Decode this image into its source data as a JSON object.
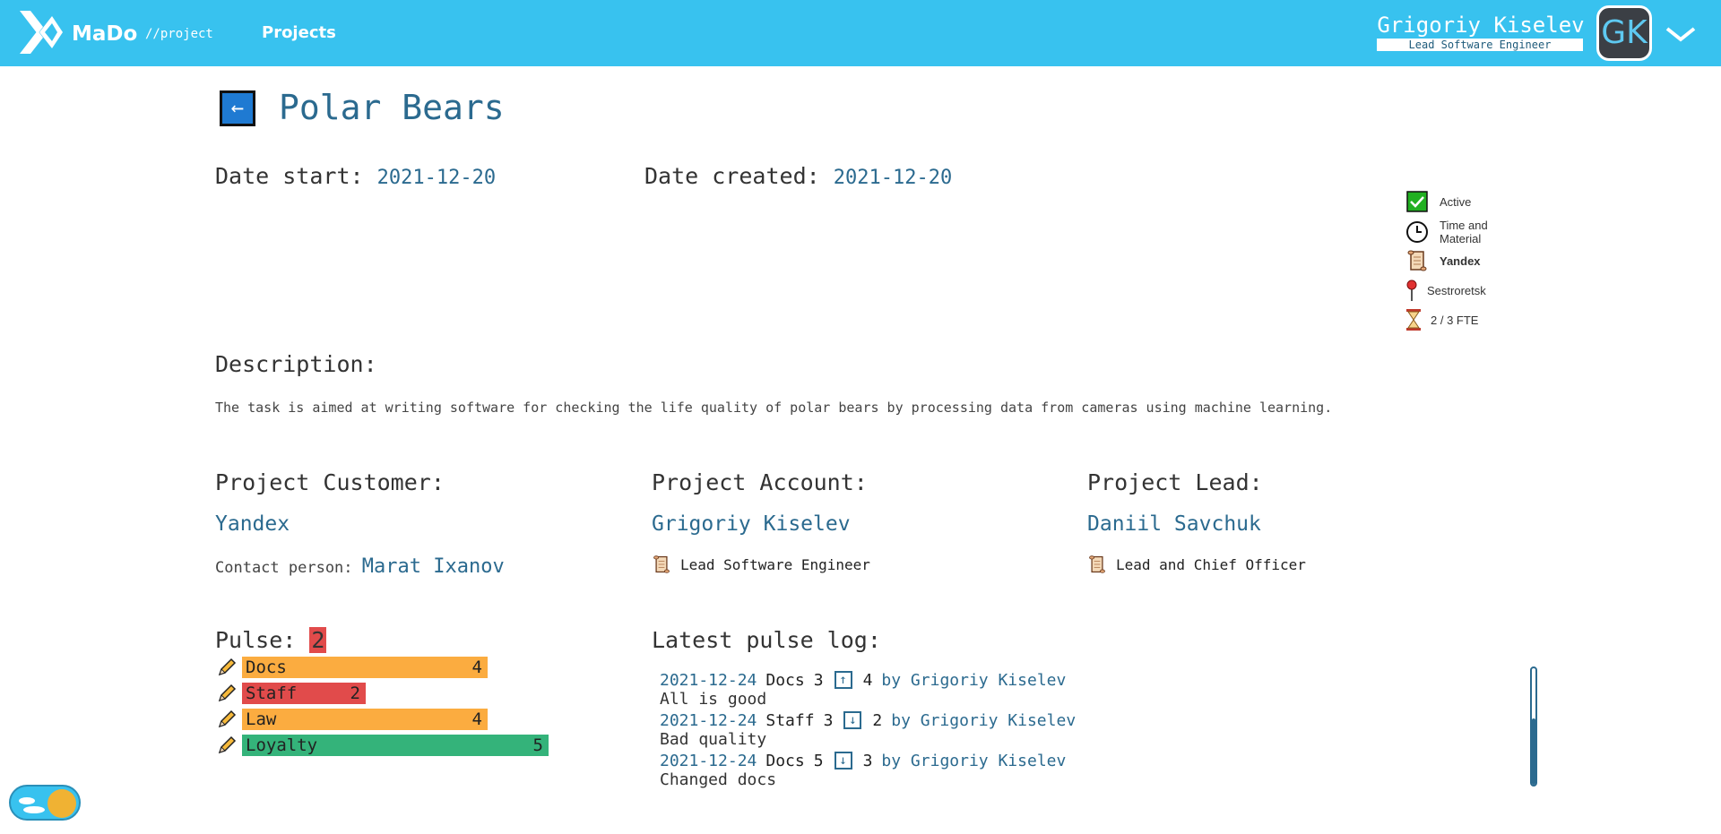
{
  "header": {
    "brand": "MaDo",
    "brand_sub": "//project",
    "nav_projects": "Projects",
    "user_name": "Grigoriy Kiselev",
    "user_role": "Lead Software Engineer",
    "avatar_initials": "GK",
    "accent_color": "#38c2ef"
  },
  "project": {
    "back_label": "←",
    "title": "Polar Bears",
    "date_start_label": "Date start:",
    "date_start": "2021-12-20",
    "date_created_label": "Date created:",
    "date_created": "2021-12-20",
    "description_label": "Description:",
    "description": "The task is aimed at writing software for checking the life quality of polar bears by processing data from cameras using machine learning."
  },
  "status": {
    "active": "Active",
    "contract_type_line1": "Time and",
    "contract_type_line2": "Material",
    "customer": "Yandex",
    "location": "Sestroretsk",
    "fte": "2 / 3 FTE"
  },
  "customer": {
    "label": "Project Customer:",
    "name": "Yandex",
    "contact_label": "Contact person:",
    "contact_name": "Marat Ixanov"
  },
  "account": {
    "label": "Project Account:",
    "name": "Grigoriy Kiselev",
    "role": "Lead Software Engineer"
  },
  "lead": {
    "label": "Project Lead:",
    "name": "Daniil Savchuk",
    "role": "Lead and Chief Officer"
  },
  "pulse": {
    "label": "Pulse:",
    "value": "2",
    "max": 5,
    "items": [
      {
        "name": "Docs",
        "value": "4",
        "score": 4,
        "color": "#fbac40"
      },
      {
        "name": "Staff",
        "value": "2",
        "score": 2,
        "color": "#e14b4b"
      },
      {
        "name": "Law",
        "value": "4",
        "score": 4,
        "color": "#fbac40"
      },
      {
        "name": "Loyalty",
        "value": "5",
        "score": 5,
        "color": "#34b37a"
      }
    ]
  },
  "pulse_log": {
    "label": "Latest pulse log:",
    "entries": [
      {
        "date": "2021-12-24",
        "key": "Docs",
        "old": "3",
        "direction": "up",
        "arrow": "↑",
        "new": "4",
        "by": "by Grigoriy Kiselev",
        "comment": "All is good"
      },
      {
        "date": "2021-12-24",
        "key": "Staff",
        "old": "3",
        "direction": "down",
        "arrow": "↓",
        "new": "2",
        "by": "by Grigoriy Kiselev",
        "comment": "Bad quality"
      },
      {
        "date": "2021-12-24",
        "key": "Docs",
        "old": "5",
        "direction": "down",
        "arrow": "↓",
        "new": "3",
        "by": "by Grigoriy Kiselev",
        "comment": "Changed docs"
      }
    ]
  }
}
